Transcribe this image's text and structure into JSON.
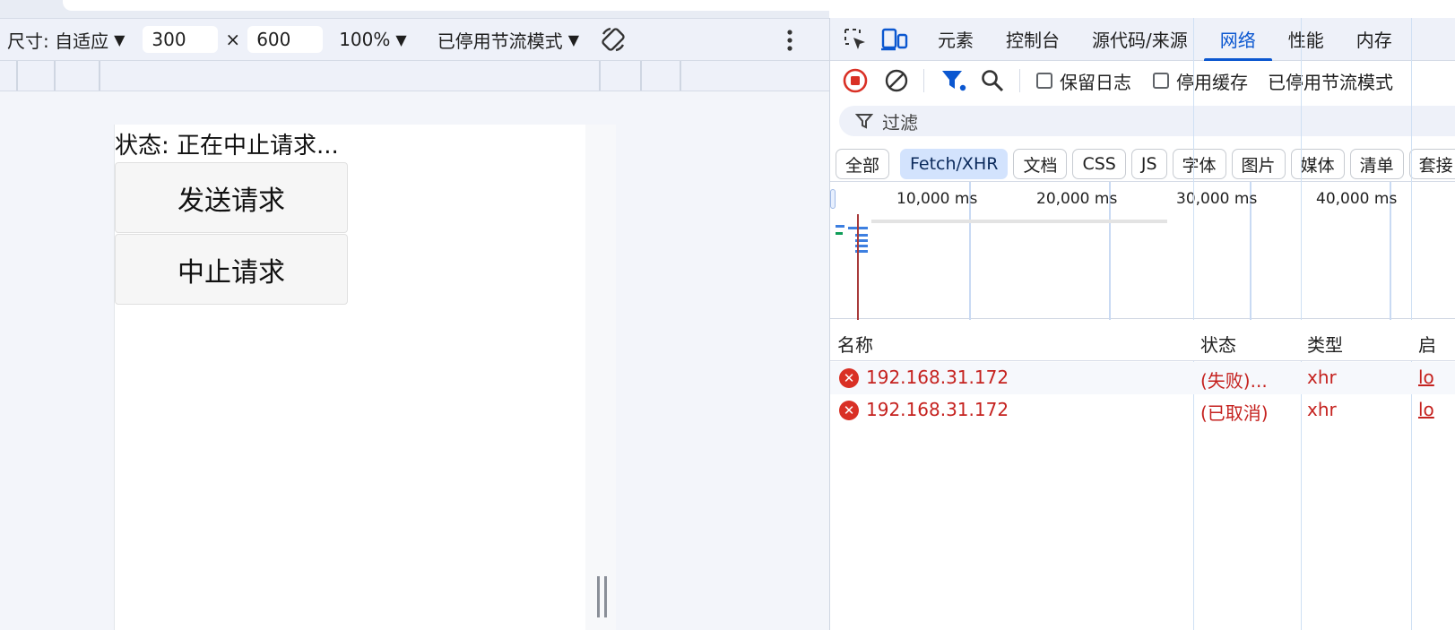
{
  "emulation_toolbar": {
    "dimensions_label": "尺寸: 自适应",
    "width_value": "300",
    "times_sign": "×",
    "height_value": "600",
    "zoom": "100%",
    "throttling": "已停用节流模式"
  },
  "page": {
    "status_text": "状态: 正在中止请求...",
    "send_button": "发送请求",
    "abort_button": "中止请求"
  },
  "devtools": {
    "tabs": [
      "元素",
      "控制台",
      "源代码/来源",
      "网络",
      "性能",
      "内存"
    ],
    "active_tab": "网络",
    "network_toolbar": {
      "preserve_log": "保留日志",
      "disable_cache": "停用缓存",
      "throttling": "已停用节流模式"
    },
    "filter_placeholder": "过滤",
    "type_filters": [
      "全部",
      "Fetch/XHR",
      "文档",
      "CSS",
      "JS",
      "字体",
      "图片",
      "媒体",
      "清单",
      "套接"
    ],
    "active_filter": "Fetch/XHR",
    "timeline_labels": [
      "10,000 ms",
      "20,000 ms",
      "30,000 ms",
      "40,000 ms"
    ],
    "table": {
      "columns": [
        "名称",
        "状态",
        "类型",
        "启"
      ],
      "rows": [
        {
          "name": "192.168.31.172",
          "status": "(失败)...",
          "type": "xhr",
          "initiator": "lo"
        },
        {
          "name": "192.168.31.172",
          "status": "(已取消)",
          "type": "xhr",
          "initiator": "lo"
        }
      ]
    }
  },
  "colors": {
    "accent": "#0b57d0",
    "error": "#c5221f",
    "record": "#d93025"
  }
}
